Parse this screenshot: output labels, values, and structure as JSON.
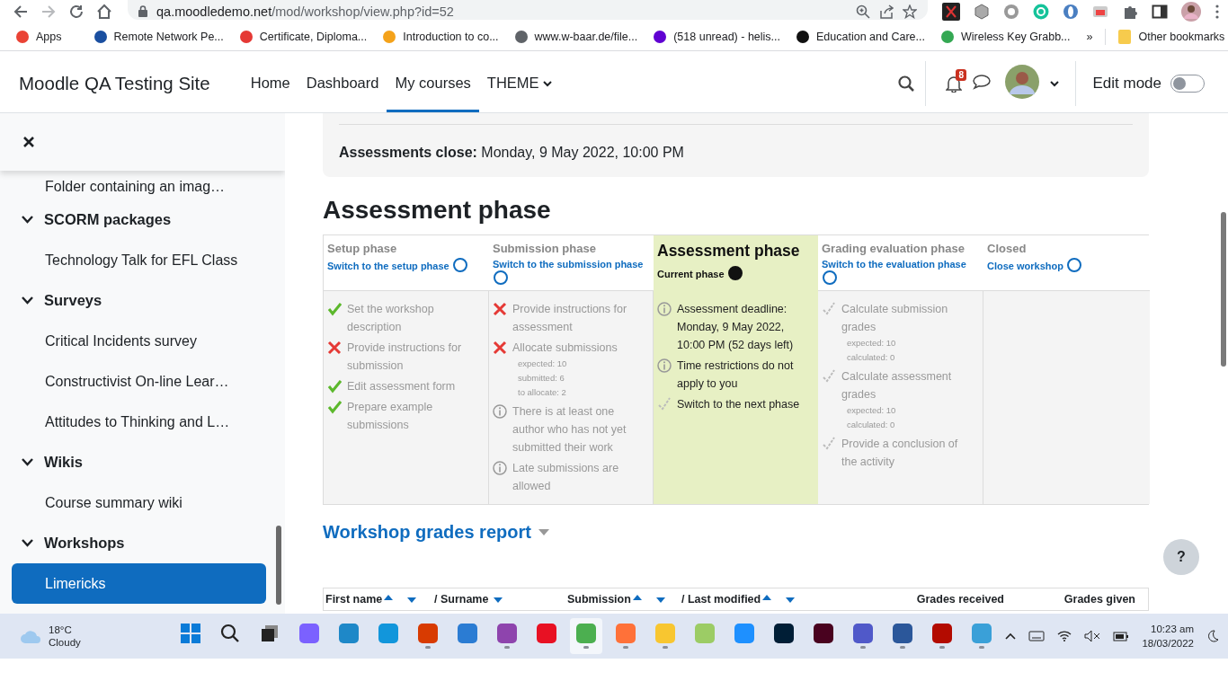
{
  "browser": {
    "url_host": "qa.moodledemo.net",
    "url_path": "/mod/workshop/view.php?id=52",
    "bookmarks": [
      {
        "label": "Apps",
        "color": "#ea4335"
      },
      {
        "label": "Remote Network Pe...",
        "color": "#1a4fa0"
      },
      {
        "label": "Certificate, Diploma...",
        "color": "#e53935"
      },
      {
        "label": "Introduction to co...",
        "color": "#f4a21a"
      },
      {
        "label": "www.w-baar.de/file...",
        "color": "#5f6368"
      },
      {
        "label": "(518 unread) - helis...",
        "color": "#6001d2"
      },
      {
        "label": "Education and Care...",
        "color": "#111111"
      },
      {
        "label": "Wireless Key Grabb...",
        "color": "#34a853"
      }
    ],
    "more": "»",
    "other": "Other bookmarks"
  },
  "navbar": {
    "site_name": "Moodle QA Testing Site",
    "links": [
      {
        "label": "Home",
        "kind": "link",
        "selected": false
      },
      {
        "label": "Dashboard",
        "kind": "link",
        "selected": false
      },
      {
        "label": "My courses",
        "kind": "link",
        "selected": true
      },
      {
        "label": "THEME",
        "kind": "dropdown",
        "selected": false
      }
    ],
    "notifications": "8",
    "edit_mode": {
      "label": "Edit mode",
      "on": false
    }
  },
  "drawer": {
    "items": [
      {
        "kind": "item",
        "label": "Folder containing an imag…",
        "selected": false
      },
      {
        "kind": "section",
        "label": "SCORM packages",
        "expanded": true,
        "children": [
          {
            "label": "Technology Talk for EFL Class",
            "selected": false
          }
        ]
      },
      {
        "kind": "section",
        "label": "Surveys",
        "expanded": true,
        "children": [
          {
            "label": "Critical Incidents survey",
            "selected": false
          },
          {
            "label": "Constructivist On-line Lear…",
            "selected": false
          },
          {
            "label": "Attitudes to Thinking and L…",
            "selected": false
          }
        ]
      },
      {
        "kind": "section",
        "label": "Wikis",
        "expanded": true,
        "children": [
          {
            "label": "Course summary wiki",
            "selected": false
          }
        ]
      },
      {
        "kind": "section",
        "label": "Workshops",
        "expanded": true,
        "children": [
          {
            "label": "Limericks",
            "selected": true
          }
        ]
      }
    ]
  },
  "info": {
    "label": "Assessments close:",
    "value": "Monday, 9 May 2022, 10:00 PM"
  },
  "heading": "Assessment phase",
  "phases": [
    {
      "title": "Setup phase",
      "current": false,
      "action": "Switch to the setup phase",
      "tasks": [
        {
          "kind": "done",
          "text": "Set the workshop description"
        },
        {
          "kind": "fail",
          "text": "Provide instructions for submission"
        },
        {
          "kind": "done",
          "text": "Edit assessment form"
        },
        {
          "kind": "done",
          "text": "Prepare example submissions"
        }
      ]
    },
    {
      "title": "Submission phase",
      "current": false,
      "action": "Switch to the submission phase",
      "tasks": [
        {
          "kind": "fail",
          "text": "Provide instructions for assessment"
        },
        {
          "kind": "fail",
          "text": "Allocate submissions",
          "details": [
            "expected: 10",
            "submitted: 6",
            "to allocate: 2"
          ]
        },
        {
          "kind": "info",
          "text": "There is at least one author who has not yet submitted their work"
        },
        {
          "kind": "info",
          "text": "Late submissions are allowed"
        }
      ]
    },
    {
      "title": "Assessment phase",
      "current": true,
      "action": "Current phase",
      "tasks": [
        {
          "kind": "info",
          "text": "Assessment deadline: Monday, 9 May 2022, 10:00 PM (52 days left)"
        },
        {
          "kind": "info",
          "text": "Time restrictions do not apply to you"
        },
        {
          "kind": "todo",
          "text": "Switch to the next phase"
        }
      ]
    },
    {
      "title": "Grading evaluation phase",
      "current": false,
      "action": "Switch to the evaluation phase",
      "tasks": [
        {
          "kind": "todo",
          "text": "Calculate submission grades",
          "details": [
            "expected: 10",
            "calculated: 0"
          ]
        },
        {
          "kind": "todo",
          "text": "Calculate assessment grades",
          "details": [
            "expected: 10",
            "calculated: 0"
          ]
        },
        {
          "kind": "todo",
          "text": "Provide a conclusion of the activity"
        }
      ]
    },
    {
      "title": "Closed",
      "current": false,
      "action": "Close workshop"
    }
  ],
  "report": {
    "title": "Workshop grades report",
    "help": "?",
    "columns": [
      {
        "label": "First name",
        "kind": "both"
      },
      {
        "label": "/ Surname",
        "kind": "down"
      },
      {
        "label": "Submission",
        "kind": "both"
      },
      {
        "label": "/ Last modified",
        "kind": "both"
      },
      {
        "label": "Grades received",
        "kind": "plain"
      },
      {
        "label": "Grades given",
        "kind": "plain"
      }
    ]
  },
  "taskbar": {
    "temp": "18°C",
    "condition": "Cloudy",
    "apps": [
      {
        "color": "#7b61ff",
        "running": false,
        "active": false
      },
      {
        "color": "#1e88c8",
        "running": false,
        "active": false
      },
      {
        "color": "#1296db",
        "running": false,
        "active": false
      },
      {
        "color": "#d83b01",
        "running": true,
        "active": false
      },
      {
        "color": "#2b7cd3",
        "running": false,
        "active": false
      },
      {
        "color": "#8e44ad",
        "running": true,
        "active": false
      },
      {
        "color": "#e81123",
        "running": false,
        "active": false
      },
      {
        "color": "#4caf50",
        "running": true,
        "active": true
      },
      {
        "color": "#ff7139",
        "running": true,
        "active": false
      },
      {
        "color": "#f8c630",
        "running": true,
        "active": false
      },
      {
        "color": "#9ccc65",
        "running": false,
        "active": false
      },
      {
        "color": "#1e90ff",
        "running": false,
        "active": false
      },
      {
        "color": "#001e36",
        "running": false,
        "active": false
      },
      {
        "color": "#49021f",
        "running": false,
        "active": false
      },
      {
        "color": "#5059c9",
        "running": true,
        "active": false
      },
      {
        "color": "#2b579a",
        "running": true,
        "active": false
      },
      {
        "color": "#b30b00",
        "running": true,
        "active": false
      },
      {
        "color": "#3aa0d8",
        "running": true,
        "active": false
      }
    ],
    "time": "10:23 am",
    "date": "18/03/2022"
  }
}
